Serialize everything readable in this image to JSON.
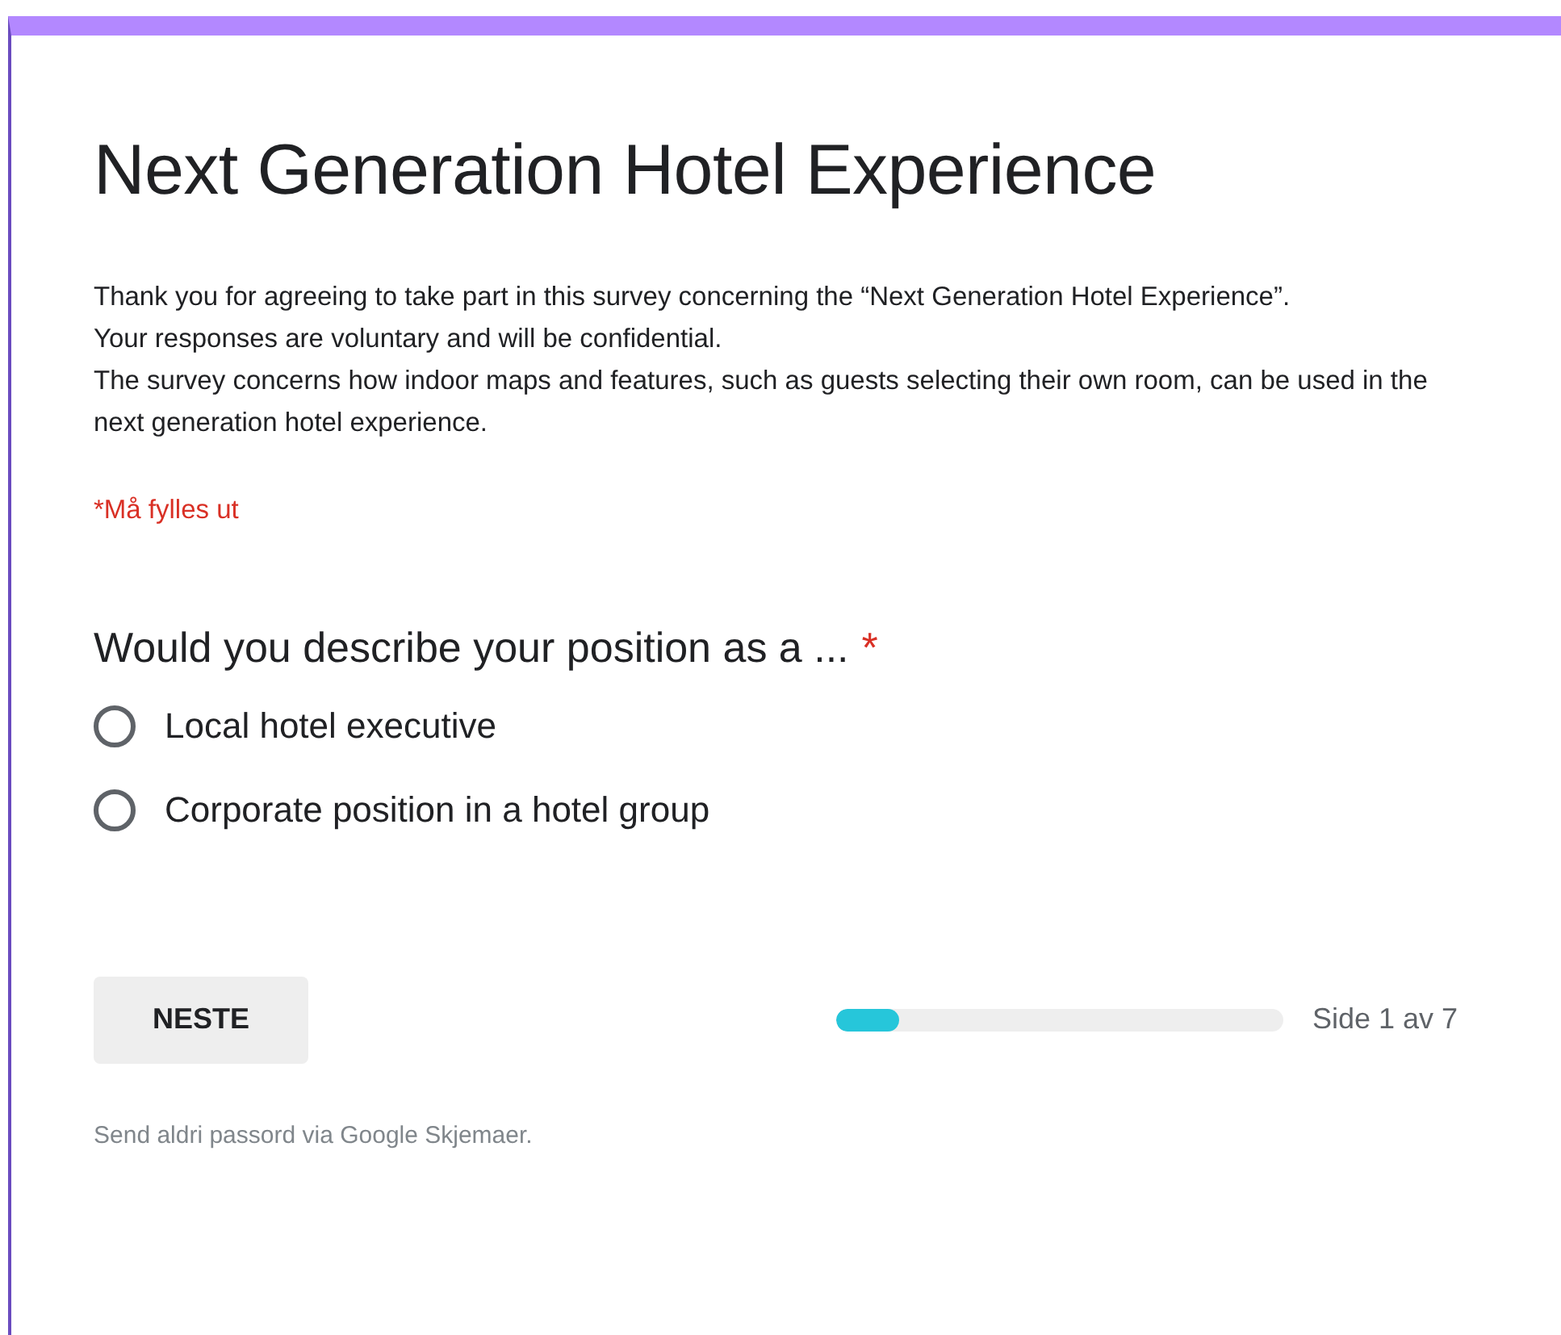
{
  "form": {
    "title": "Next Generation Hotel Experience",
    "description": [
      "Thank you for agreeing to take part in this survey concerning the “Next Generation Hotel Experience”.",
      "Your responses are voluntary and will be confidential.",
      "The survey concerns how indoor maps and features, such as guests selecting their own room, can be used in the next generation hotel experience."
    ],
    "required_note": "*Må fylles ut"
  },
  "question": {
    "title": "Would you describe your position as a ...",
    "required_mark": "*",
    "options": [
      {
        "label": "Local hotel executive",
        "selected": false
      },
      {
        "label": "Corporate position in a hotel group",
        "selected": false
      }
    ]
  },
  "next_button": "NESTE",
  "progress": {
    "level": 0.14,
    "label": "Side 1 av 7"
  },
  "footer": "Send aldri passord via Google Skjemaer."
}
